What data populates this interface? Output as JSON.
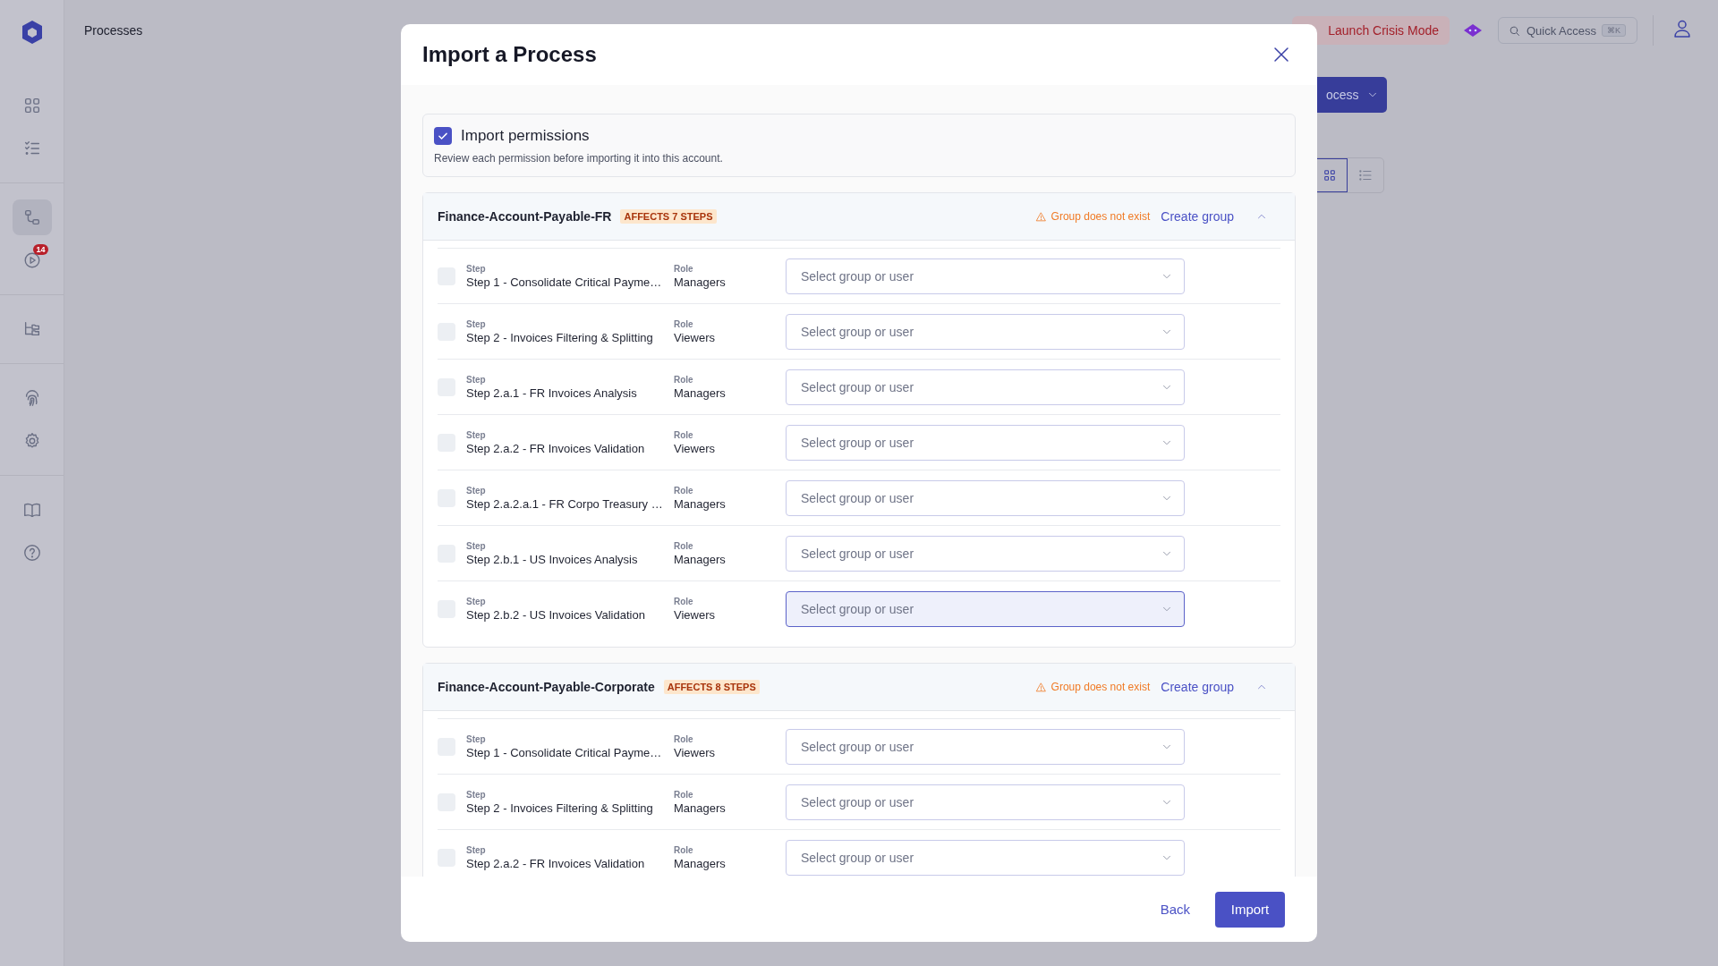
{
  "app": {
    "page_title": "Processes"
  },
  "sidebar": {
    "groups": [
      [
        {
          "selected": false
        },
        {
          "selected": false
        }
      ],
      [
        {
          "selected": true
        },
        {
          "selected": false,
          "badge": "14"
        }
      ],
      [
        {
          "selected": false
        }
      ],
      [
        {
          "selected": false
        },
        {
          "selected": false
        }
      ],
      [
        {
          "selected": false
        },
        {
          "selected": false
        }
      ]
    ]
  },
  "topbar": {
    "crisis_button": "Launch Crisis Mode",
    "quick_access": {
      "label": "Quick Access",
      "shortcut": "⌘K"
    }
  },
  "page": {
    "process_button": "ocess",
    "view_toggle": [
      {
        "selected": true
      },
      {
        "selected": false
      }
    ]
  },
  "modal": {
    "title": "Import a Process",
    "import_permissions": {
      "label": "Import permissions",
      "checked": true,
      "description": "Review each permission before importing it into this account."
    },
    "groups": [
      {
        "name": "Finance-Account-Payable-FR",
        "badge": "AFFECTS 7 STEPS",
        "warning": "Group does not exist",
        "action": "Create group",
        "expanded": true,
        "rows": [
          {
            "step_label": "Step",
            "step": "Step 1 - Consolidate Critical Payme…",
            "role_label": "Role",
            "role": "Managers",
            "placeholder": "Select group or user",
            "checked": false,
            "focused": false
          },
          {
            "step_label": "Step",
            "step": "Step 2 - Invoices Filtering & Splitting",
            "role_label": "Role",
            "role": "Viewers",
            "placeholder": "Select group or user",
            "checked": false,
            "focused": false
          },
          {
            "step_label": "Step",
            "step": "Step 2.a.1 - FR Invoices Analysis",
            "role_label": "Role",
            "role": "Managers",
            "placeholder": "Select group or user",
            "checked": false,
            "focused": false
          },
          {
            "step_label": "Step",
            "step": "Step 2.a.2 - FR Invoices Validation",
            "role_label": "Role",
            "role": "Viewers",
            "placeholder": "Select group or user",
            "checked": false,
            "focused": false
          },
          {
            "step_label": "Step",
            "step": "Step 2.a.2.a.1 - FR Corpo Treasury …",
            "role_label": "Role",
            "role": "Managers",
            "placeholder": "Select group or user",
            "checked": false,
            "focused": false
          },
          {
            "step_label": "Step",
            "step": "Step 2.b.1 - US Invoices Analysis",
            "role_label": "Role",
            "role": "Managers",
            "placeholder": "Select group or user",
            "checked": false,
            "focused": false
          },
          {
            "step_label": "Step",
            "step": "Step 2.b.2 - US Invoices Validation",
            "role_label": "Role",
            "role": "Viewers",
            "placeholder": "Select group or user",
            "checked": false,
            "focused": true
          }
        ]
      },
      {
        "name": "Finance-Account-Payable-Corporate",
        "badge": "AFFECTS 8 STEPS",
        "warning": "Group does not exist",
        "action": "Create group",
        "expanded": true,
        "rows": [
          {
            "step_label": "Step",
            "step": "Step 1 - Consolidate Critical Payme…",
            "role_label": "Role",
            "role": "Viewers",
            "placeholder": "Select group or user",
            "checked": false,
            "focused": false
          },
          {
            "step_label": "Step",
            "step": "Step 2 - Invoices Filtering & Splitting",
            "role_label": "Role",
            "role": "Managers",
            "placeholder": "Select group or user",
            "checked": false,
            "focused": false
          },
          {
            "step_label": "Step",
            "step": "Step 2.a.2 - FR Invoices Validation",
            "role_label": "Role",
            "role": "Managers",
            "placeholder": "Select group or user",
            "checked": false,
            "focused": false
          }
        ]
      }
    ],
    "buttons": {
      "back": "Back",
      "import": "Import"
    }
  }
}
